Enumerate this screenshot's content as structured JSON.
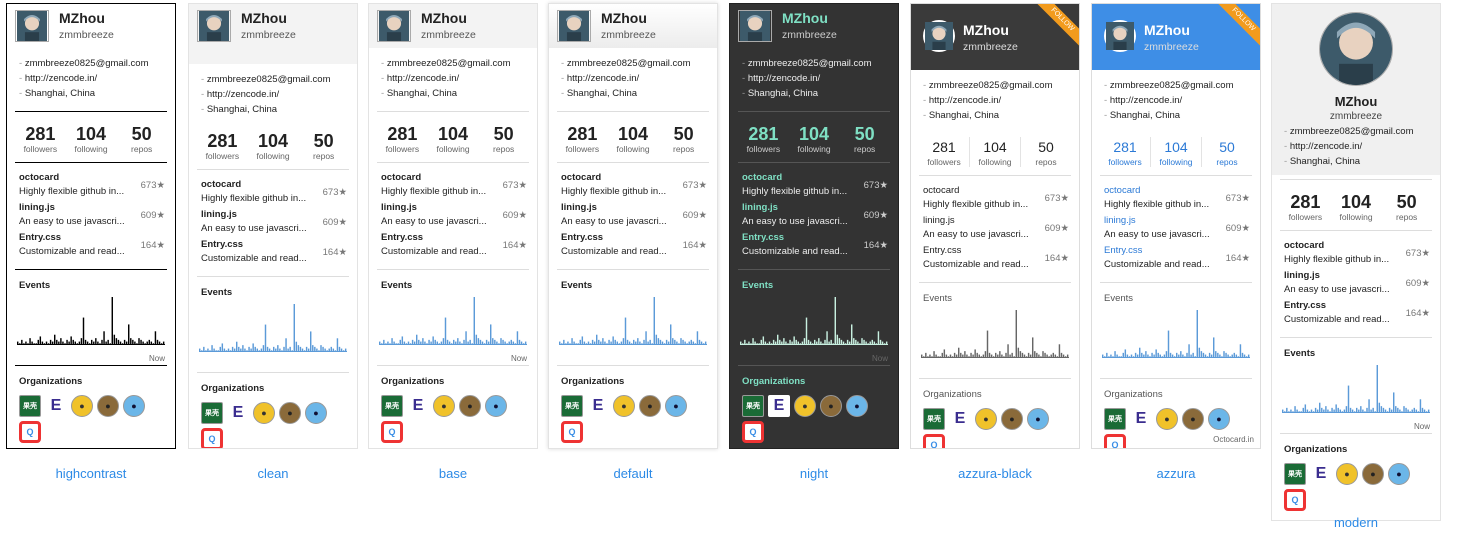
{
  "profile": {
    "name": "MZhou",
    "username": "zmmbreeze",
    "email": "zmmbreeze0825@gmail.com",
    "website": "http://zencode.in/",
    "location": "Shanghai, China"
  },
  "stats": [
    {
      "value": "281",
      "label": "followers"
    },
    {
      "value": "104",
      "label": "following"
    },
    {
      "value": "50",
      "label": "repos"
    }
  ],
  "repos": [
    {
      "name": "octocard",
      "desc": "Highly flexible github in...",
      "stars": "673★"
    },
    {
      "name": "lining.js",
      "desc": "An easy to use javascri...",
      "stars": "609★"
    },
    {
      "name": "Entry.css",
      "desc": "Customizable and read...",
      "stars": "164★"
    }
  ],
  "events_title": "Events",
  "now_label": "Now",
  "orgs_title": "Organizations",
  "orgs": [
    "果壳",
    "E",
    "●",
    "●",
    "●",
    "Q"
  ],
  "follow_label": "FOLLOW",
  "footer": "Octocard.in",
  "themes": [
    "highcontrast",
    "clean",
    "base",
    "default",
    "night",
    "azzura-black",
    "azzura",
    "modern"
  ],
  "events_values": [
    2,
    1,
    3,
    1,
    2,
    1,
    4,
    2,
    1,
    1,
    3,
    5,
    2,
    1,
    2,
    1,
    3,
    2,
    6,
    3,
    2,
    4,
    2,
    1,
    3,
    2,
    5,
    3,
    2,
    1,
    2,
    4,
    16,
    3,
    2,
    1,
    3,
    2,
    4,
    2,
    1,
    3,
    8,
    2,
    3,
    1,
    28,
    6,
    4,
    3,
    2,
    1,
    3,
    2,
    12,
    4,
    3,
    2,
    1,
    4,
    3,
    2,
    1,
    2,
    3,
    2,
    1,
    8,
    3,
    2,
    1,
    2
  ]
}
